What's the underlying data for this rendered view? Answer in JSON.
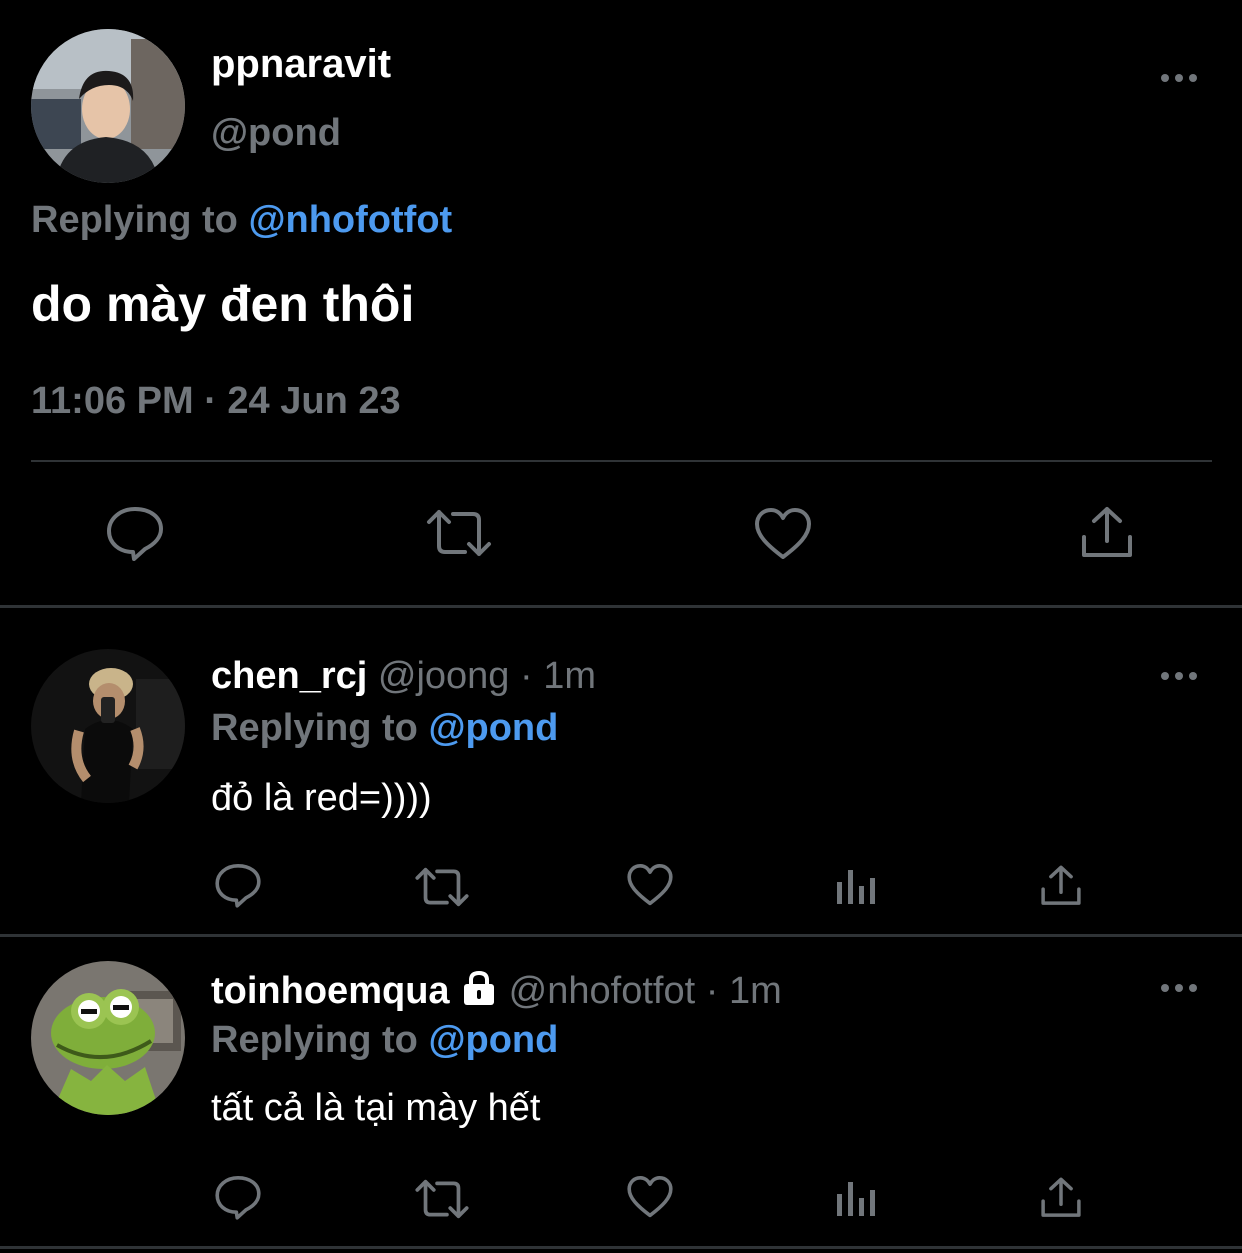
{
  "main_tweet": {
    "display_name": "ppnaravit",
    "handle": "@pond",
    "replying_prefix": "Replying to ",
    "replying_handle": "@nhofotfot",
    "text": "do mày đen thôi",
    "timestamp": "11:06 PM · 24 Jun 23",
    "actions": [
      "reply-icon",
      "retweet-icon",
      "like-icon",
      "share-icon"
    ]
  },
  "replies": [
    {
      "display_name": "chen_rcj",
      "handle": "@joong",
      "time": "1m",
      "separator": "·",
      "replying_prefix": "Replying to ",
      "replying_handle": "@pond",
      "text": "đỏ là red=))))",
      "protected": false
    },
    {
      "display_name": "toinhoemqua",
      "handle": "@nhofotfot",
      "time": "1m",
      "separator": "·",
      "replying_prefix": "Replying to ",
      "replying_handle": "@pond",
      "text": "tất cả là tại mày hết",
      "protected": true
    }
  ],
  "colors": {
    "background": "#000000",
    "text": "#ffffff",
    "muted": "#71767b",
    "accent": "#4d9aef",
    "divider": "#2f3336"
  }
}
